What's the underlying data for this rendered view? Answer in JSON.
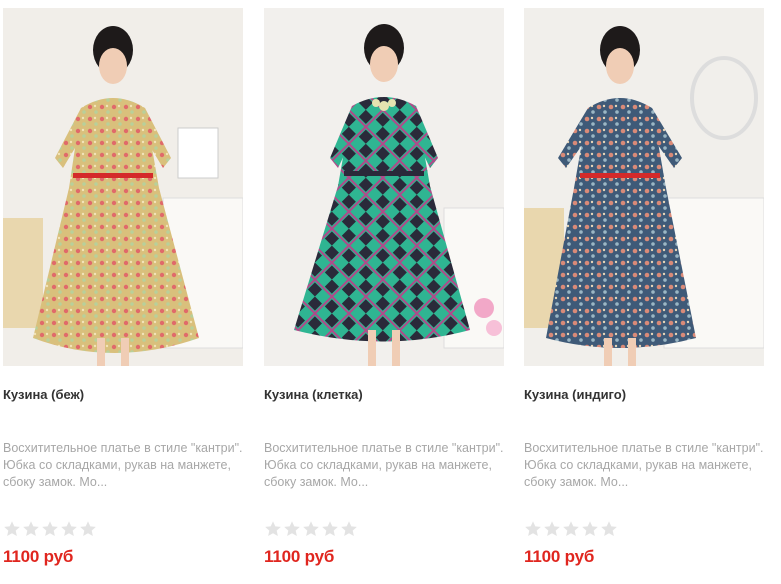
{
  "products": [
    {
      "image": "photo of a model in a beige floral dress",
      "title": "Кузина (беж)",
      "description": "Восхитительное платье в стиле \"кантри\". Юбка со складками, рукав на манжете, сбоку замок. Мо...",
      "rating": 0,
      "price": "1100 руб",
      "dress_color": "#d9c07c"
    },
    {
      "image": "photo of a model in a green plaid dress",
      "title": "Кузина (клетка)",
      "description": "Восхитительное платье в стиле \"кантри\". Юбка со складками, рукав на манжете, сбоку замок. Мо...",
      "rating": 0,
      "price": "1100 руб",
      "dress_color": "#2fb592"
    },
    {
      "image": "photo of a model in an indigo floral dress",
      "title": "Кузина (индиго)",
      "description": "Восхитительное платье в стиле \"кантри\". Юбка со складками, рукав на манжете, сбоку замок. Мо...",
      "rating": 0,
      "price": "1100 руб",
      "dress_color": "#3f5a78"
    }
  ],
  "colors": {
    "price": "#e0261f",
    "title": "#333333",
    "description": "#a7a7a7",
    "star_empty": "#e3e3e3"
  }
}
